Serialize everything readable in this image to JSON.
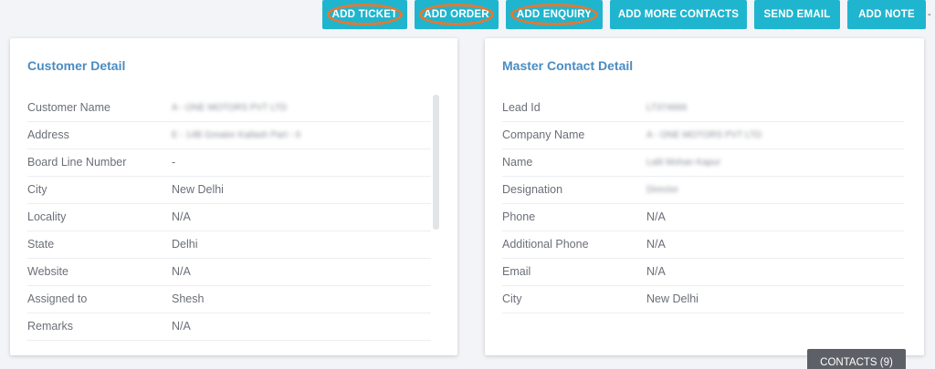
{
  "toolbar": {
    "add_ticket": "ADD TICKET",
    "add_order": "ADD ORDER",
    "add_enquiry": "ADD ENQUIRY",
    "add_more_contacts": "ADD MORE CONTACTS",
    "send_email": "SEND EMAIL",
    "add_note": "ADD NOTE",
    "trailing": "-"
  },
  "customer": {
    "title": "Customer Detail",
    "rows": [
      {
        "label": "Customer Name",
        "value": "A - ONE MOTORS PVT LTD"
      },
      {
        "label": "Address",
        "value": "E - 14B Greater Kailash Part - II"
      },
      {
        "label": "Board Line Number",
        "value": "-"
      },
      {
        "label": "City",
        "value": "New Delhi"
      },
      {
        "label": "Locality",
        "value": "N/A"
      },
      {
        "label": "State",
        "value": "Delhi"
      },
      {
        "label": "Website",
        "value": "N/A"
      },
      {
        "label": "Assigned to",
        "value": "Shesh"
      },
      {
        "label": "Remarks",
        "value": "N/A"
      }
    ]
  },
  "master": {
    "title": "Master Contact Detail",
    "rows": [
      {
        "label": "Lead Id",
        "value": "LT374666"
      },
      {
        "label": "Company Name",
        "value": "A - ONE MOTORS PVT LTD"
      },
      {
        "label": "Name",
        "value": "Lalit Mohan Kapur"
      },
      {
        "label": "Designation",
        "value": "Director"
      },
      {
        "label": "Phone",
        "value": "N/A"
      },
      {
        "label": "Additional Phone",
        "value": "N/A"
      },
      {
        "label": "Email",
        "value": "N/A"
      },
      {
        "label": "City",
        "value": "New Delhi"
      }
    ]
  },
  "contacts_tab": "CONTACTS (9)",
  "colors": {
    "button_bg": "#1fb5cf",
    "highlight_ring": "#e8772e",
    "title": "#4a8cc2"
  }
}
